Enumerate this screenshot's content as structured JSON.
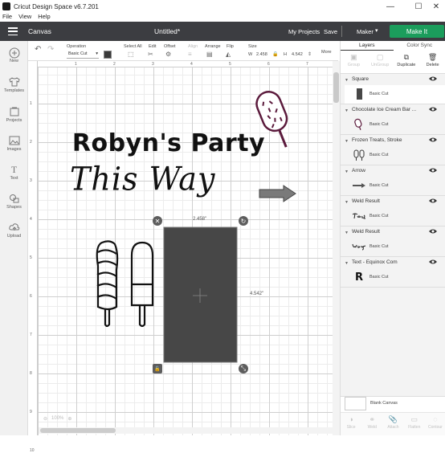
{
  "window": {
    "title": "Cricut Design Space  v6.7.201",
    "minimize": "—",
    "maximize": "☐",
    "close": "✕"
  },
  "menu": {
    "items": [
      "File",
      "View",
      "Help"
    ]
  },
  "topbar": {
    "section": "Canvas",
    "doc_title": "Untitled*",
    "my_projects": "My Projects",
    "save": "Save",
    "machine": "Maker",
    "make_it": "Make It"
  },
  "editbar": {
    "undo_icon": "undo-icon",
    "redo_icon": "redo-icon",
    "operation_label": "Operation",
    "operation_value": "Basic Cut",
    "operation_chev": "▾",
    "select_all": "Select All",
    "edit": "Edit",
    "offset": "Offset",
    "align": "Align",
    "arrange": "Arrange",
    "flip": "Flip",
    "size": "Size",
    "w_label": "W",
    "w_value": "2.458",
    "h_label": "H",
    "h_value": "4.542",
    "more": "More",
    "color": "#3a3a3a"
  },
  "left_tools": [
    {
      "label": "New",
      "icon": "plus-icon"
    },
    {
      "label": "Templates",
      "icon": "shirt-icon"
    },
    {
      "label": "Projects",
      "icon": "projects-icon"
    },
    {
      "label": "Images",
      "icon": "image-icon"
    },
    {
      "label": "Text",
      "icon": "text-icon"
    },
    {
      "label": "Shapes",
      "icon": "shapes-icon"
    },
    {
      "label": "Upload",
      "icon": "upload-icon"
    }
  ],
  "rulers": {
    "left": [
      "1",
      "2",
      "3",
      "4",
      "5",
      "6",
      "7",
      "8",
      "9",
      "10"
    ],
    "top": [
      "1",
      "2",
      "3",
      "4",
      "5",
      "6",
      "7"
    ]
  },
  "canvas": {
    "headline": "Robyn's Party",
    "script": "This Way",
    "selection": {
      "width_label": "2.458\"",
      "height_label": "4.542\"",
      "fill": "#474747"
    },
    "zoom": "100%"
  },
  "panel": {
    "tabs": [
      "Layers",
      "Color Sync"
    ],
    "actions": [
      "Group",
      "UnGroup",
      "Duplicate",
      "Delete"
    ],
    "layers": [
      {
        "name": "Square",
        "op": "Basic Cut",
        "thumb": "square-thumb"
      },
      {
        "name": "Chocolate Ice Cream Bar ...",
        "op": "Basic Cut",
        "thumb": "icecream-bar-thumb"
      },
      {
        "name": "Frozen Treats, Stroke",
        "op": "Basic Cut",
        "thumb": "frozen-treats-thumb"
      },
      {
        "name": "Arrow",
        "op": "Basic Cut",
        "thumb": "arrow-thumb"
      },
      {
        "name": "Weld Result",
        "op": "Basic Cut",
        "thumb": "script-thumb-this"
      },
      {
        "name": "Weld Result",
        "op": "Basic Cut",
        "thumb": "script-thumb-way"
      },
      {
        "name": "Text - Equinox Com",
        "op": "Basic Cut",
        "thumb": "R"
      }
    ],
    "blank_canvas": "Blank Canvas",
    "bottom_actions": [
      "Slice",
      "Weld",
      "Attach",
      "Flatten",
      "Contour"
    ]
  }
}
